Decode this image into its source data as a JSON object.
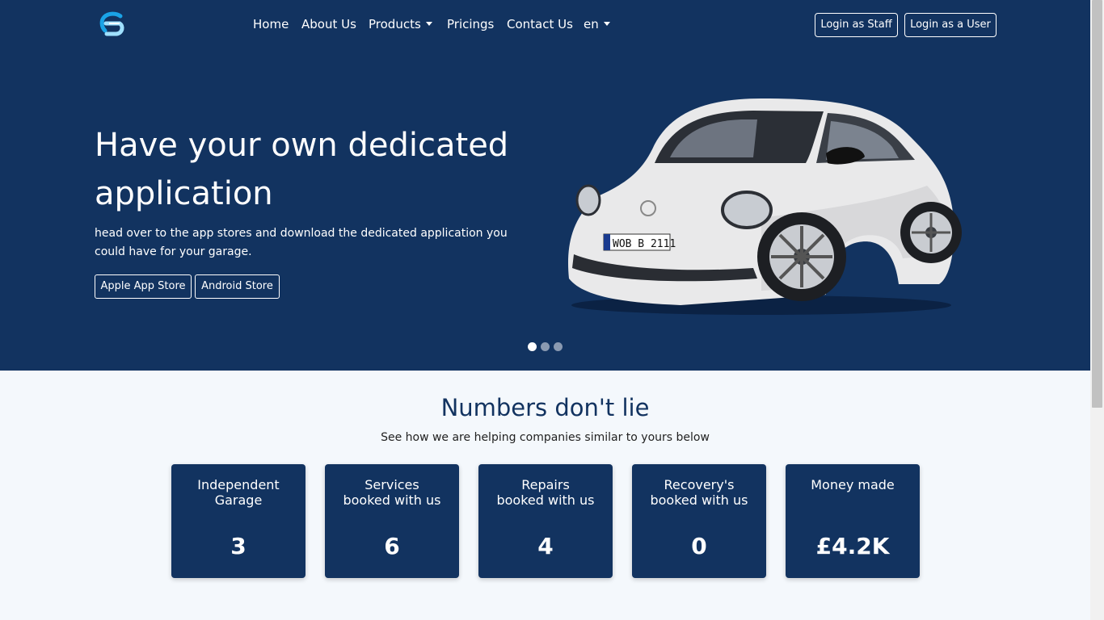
{
  "nav": {
    "logo": "logo-icon",
    "links": [
      "Home",
      "About Us",
      "Products",
      "Pricings",
      "Contact Us",
      "en"
    ],
    "login_staff": "Login as Staff",
    "login_user": "Login as a User"
  },
  "hero": {
    "title": "Have your own dedicated application",
    "subtitle": "head over to the app stores and download the dedicated application you could have for your garage.",
    "buttons": [
      "Apple App Store",
      "Android Store"
    ],
    "car_plate": "WOB B 2111",
    "carousel": {
      "total": 3,
      "active": 1
    }
  },
  "stats": {
    "title": "Numbers don't lie",
    "subtitle": "See how we are helping companies similar to yours below",
    "cards": [
      {
        "label": "Independent Garage",
        "value": "3"
      },
      {
        "label": "Services booked with us",
        "value": "6"
      },
      {
        "label": "Repairs booked with us",
        "value": "4"
      },
      {
        "label": "Recovery's booked with us",
        "value": "0"
      },
      {
        "label": "Money made",
        "value": "£4.2K"
      }
    ]
  },
  "colors": {
    "primary": "#123360",
    "page_background": "#f4f8fc",
    "logo_blue": "#1aa3e6"
  }
}
